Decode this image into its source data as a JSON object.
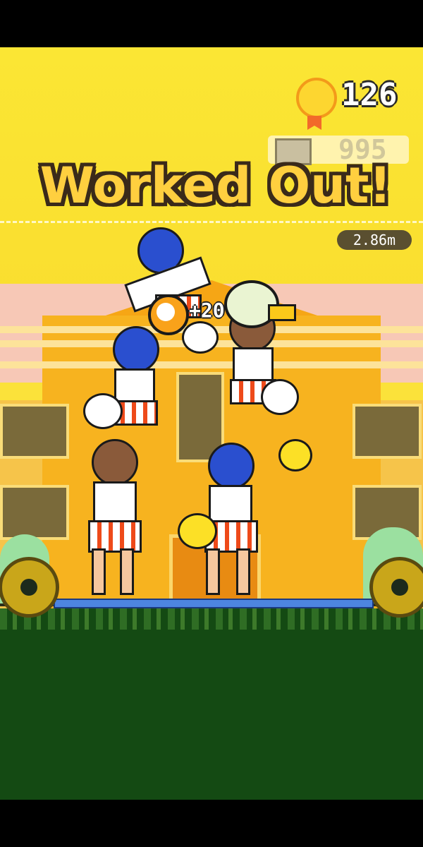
{
  "hud": {
    "coin_count": "126",
    "best_count": "995",
    "height": "2.86m",
    "title": "Worked Out!",
    "bonus": "+20"
  },
  "colors": {
    "sky": "#fbe23a",
    "building": "#f7b31f",
    "grass": "#144a13",
    "uniform_accent": "#ee4a1a"
  },
  "icons": [
    "medal-coin-icon",
    "best-record-icon",
    "stopwatch-icon",
    "bird-icon"
  ]
}
